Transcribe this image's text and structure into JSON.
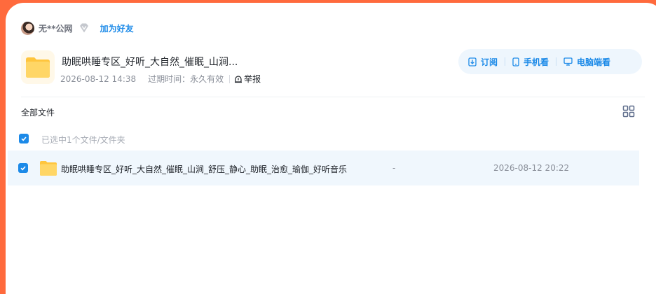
{
  "user": {
    "name": "无**公网",
    "add_friend": "加为好友"
  },
  "share": {
    "title": "助眠哄睡专区_好听_大自然_催眠_山涧...",
    "date": "2026-08-12 14:38",
    "expire_label": "过期时间：",
    "expire_value": "永久有效",
    "report": "举报"
  },
  "actions": {
    "subscribe": "订阅",
    "mobile": "手机看",
    "pc": "电脑端看"
  },
  "breadcrumb": "全部文件",
  "selection_info": "已选中1个文件/文件夹",
  "files": [
    {
      "name": "助眠哄睡专区_好听_大自然_催眠_山涧_舒压_静心_助眠_治愈_瑜伽_好听音乐",
      "size": "-",
      "date": "2026-08-12 20:22",
      "checked": true
    }
  ],
  "colors": {
    "accent": "#1c8ae8",
    "frame": "#ff6a3d",
    "selected_row": "#f0f7fd"
  }
}
